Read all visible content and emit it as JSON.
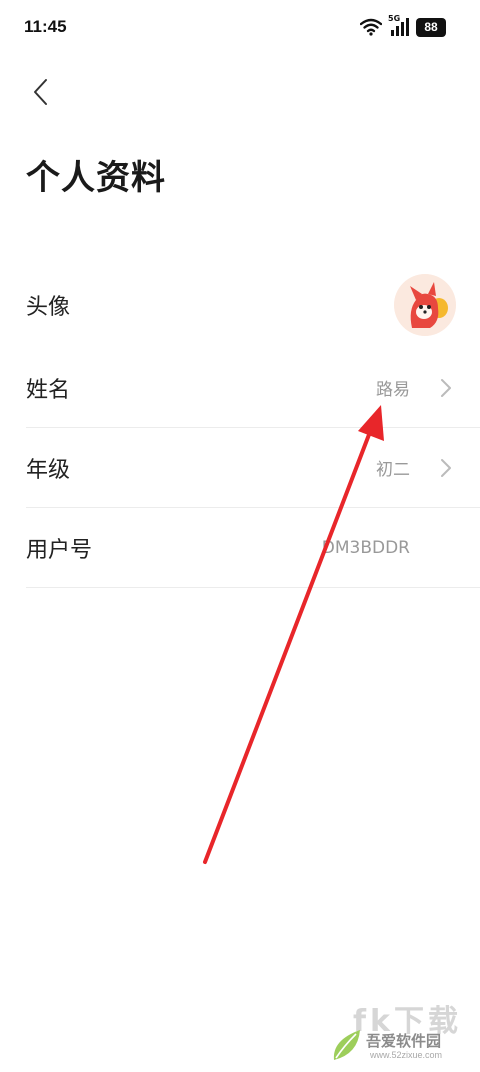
{
  "status_bar": {
    "time": "11:45",
    "network_tag": "5G",
    "battery": "88"
  },
  "header": {
    "back_icon": "chevron-left-icon",
    "title": "个人资料"
  },
  "profile": {
    "avatar_label": "头像",
    "name_label": "姓名",
    "name_value": "路易",
    "grade_label": "年级",
    "grade_value": "初二",
    "user_id_label": "用户号",
    "user_id_value": "DM3BDDR"
  },
  "annotation": {
    "arrow_color": "#e8262a"
  },
  "watermark": {
    "big_text": "fk下载",
    "site_name": "吾爱软件园",
    "site_url": "www.52zixue.com"
  },
  "colors": {
    "text_primary": "#222222",
    "text_secondary": "#999999",
    "divider": "#ececec"
  }
}
